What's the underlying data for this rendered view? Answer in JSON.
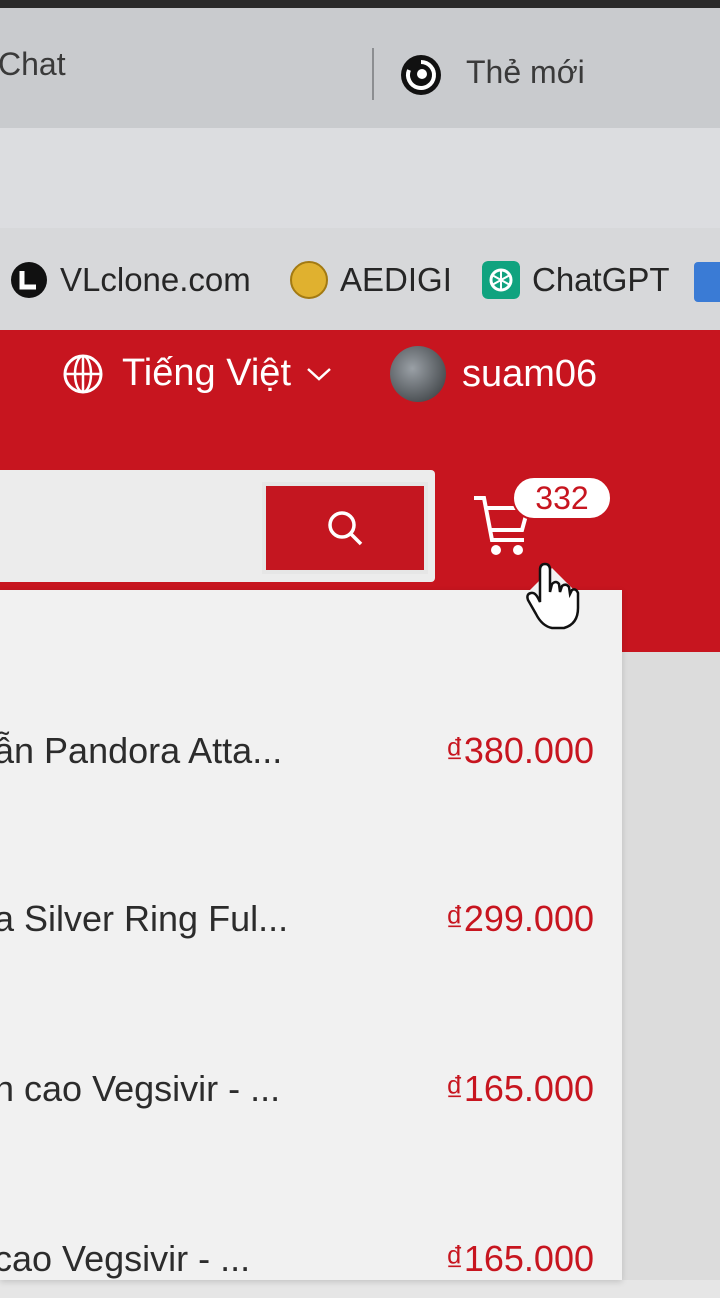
{
  "browser": {
    "tabs": [
      {
        "label": "Chat"
      },
      {
        "label": "Thẻ mới",
        "icon": "spiral-icon"
      }
    ],
    "bookmarks": [
      {
        "label": "VLclone.com",
        "icon": "vlclone-icon",
        "color": "#111111"
      },
      {
        "label": "AEDIGI",
        "icon": "aedigi-icon",
        "color": "#e0b12f"
      },
      {
        "label": "ChatGPT",
        "icon": "chatgpt-icon",
        "color": "#10a37f"
      }
    ]
  },
  "header": {
    "language": "Tiếng Việt",
    "username": "suam06",
    "cart_count": "332",
    "accent_color": "#c7151f"
  },
  "cart_items": [
    {
      "name": "ẫn Pandora Atta...",
      "price": "₫380.000"
    },
    {
      "name": "a Silver Ring Ful...",
      "price": "₫299.000"
    },
    {
      "name": "n cao Vegsivir - ...",
      "price": "₫165.000"
    },
    {
      "name": "cao Vegsivir - ...",
      "price": "₫165.000"
    }
  ]
}
